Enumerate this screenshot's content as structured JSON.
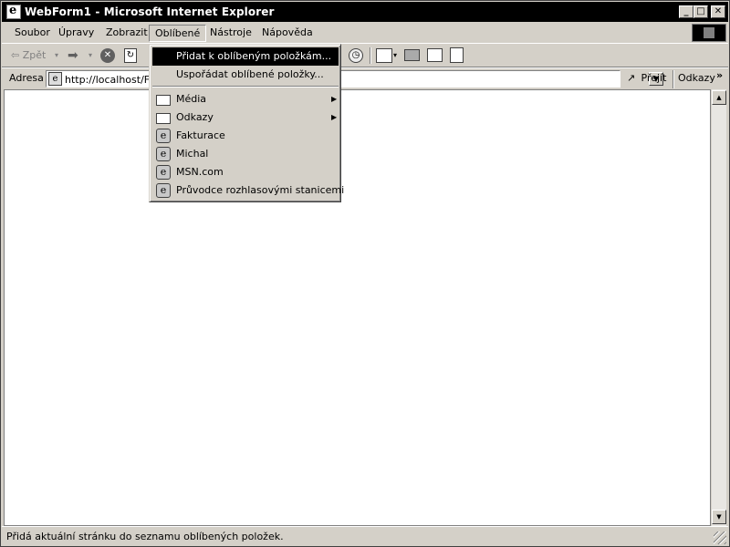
{
  "window": {
    "title": "WebForm1 - Microsoft Internet Explorer",
    "minimize_glyph": "_",
    "maximize_glyph": "□",
    "close_glyph": "✕"
  },
  "menubar": {
    "items": [
      "Soubor",
      "Úpravy",
      "Zobrazit",
      "Oblíbené",
      "Nástroje",
      "Nápověda"
    ],
    "active": "Oblíbené"
  },
  "toolbar": {
    "back_label": "⇦ Zpět",
    "forward_glyph": "➡",
    "dropdown_glyph": "▾",
    "stop_glyph": "✕",
    "refresh_glyph": "↻",
    "history_glyph": "◷"
  },
  "addressbar": {
    "label": "Adresa",
    "url": "http://localhost/Fal",
    "page_icon_glyph": "e",
    "dropdown_glyph": "▼",
    "go_label": "Přejít",
    "go_glyph": "↗",
    "links_label": "Odkazy",
    "links_chevron": "»"
  },
  "scrollbar": {
    "up_glyph": "▲",
    "down_glyph": "▼"
  },
  "favorites_menu": {
    "items": [
      {
        "label": "Přidat k oblíbeným položkám...",
        "type": "action",
        "selected": true
      },
      {
        "label": "Uspořádat oblíbené položky...",
        "type": "action",
        "selected": false
      },
      {
        "label": "Média",
        "type": "folder",
        "submenu": true,
        "icon": "folder-icon"
      },
      {
        "label": "Odkazy",
        "type": "folder",
        "submenu": true,
        "icon": "folder-icon"
      },
      {
        "label": "Fakturace",
        "type": "link",
        "icon": "ie-page-icon"
      },
      {
        "label": "Michal",
        "type": "link",
        "icon": "ie-page-icon"
      },
      {
        "label": "MSN.com",
        "type": "link",
        "icon": "ie-page-icon"
      },
      {
        "label": "Průvodce rozhlasovými stanicemi",
        "type": "link",
        "icon": "ie-page-icon"
      }
    ],
    "submenu_arrow_glyph": "▶",
    "ie_icon_glyph": "e"
  },
  "statusbar": {
    "text": "Přidá aktuální stránku do seznamu oblíbených položek."
  },
  "colors": {
    "chrome": "#d4d0c8",
    "titlebar": "#000000",
    "selection": "#000000",
    "content": "#ffffff"
  }
}
